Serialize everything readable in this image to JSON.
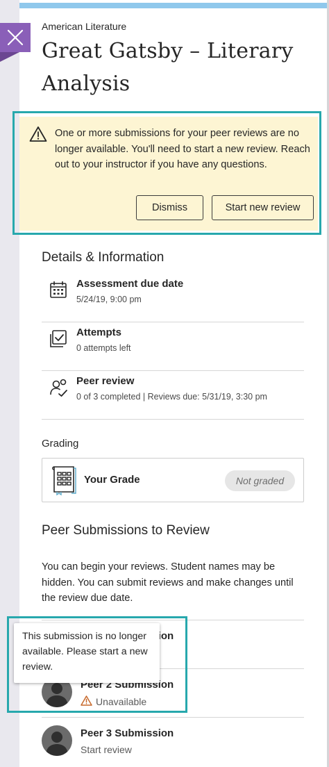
{
  "header": {
    "course_name": "American Literature",
    "page_title": "Great Gatsby – Literary Analysis"
  },
  "alert": {
    "message": "One or more submissions for your peer reviews are no longer available. You'll need to start a new review. Reach out to your instructor if you have any questions.",
    "dismiss_label": "Dismiss",
    "start_new_label": "Start new review"
  },
  "details": {
    "heading": "Details & Information",
    "items": [
      {
        "label": "Assessment due date",
        "value": "5/24/19, 9:00 pm",
        "icon": "calendar-icon"
      },
      {
        "label": "Attempts",
        "value": "0 attempts left",
        "icon": "attempts-icon"
      },
      {
        "label": "Peer review",
        "value": "0 of 3 completed | Reviews due: 5/31/19, 3:30 pm",
        "icon": "peer-review-icon"
      }
    ]
  },
  "grading": {
    "label": "Grading",
    "grade_label": "Your Grade",
    "grade_status": "Not graded"
  },
  "peer": {
    "heading": "Peer Submissions to Review",
    "description": "You can begin your reviews. Student names may be hidden. You can submit reviews and make changes until the review due date.",
    "submissions": [
      {
        "label": "Peer 1 Submission",
        "status": ""
      },
      {
        "label": "Peer 2 Submission",
        "status": "Unavailable"
      },
      {
        "label": "Peer 3 Submission",
        "status": "Start review"
      }
    ]
  },
  "tooltip": {
    "text": "This submission is no longer available. Please start a new review."
  },
  "colors": {
    "accent_purple": "#8a5fb8",
    "highlight_teal": "#27a8ad",
    "alert_background": "#fdf5d3",
    "top_bar": "#8fc8ec",
    "warning_orange": "#c7692b"
  }
}
